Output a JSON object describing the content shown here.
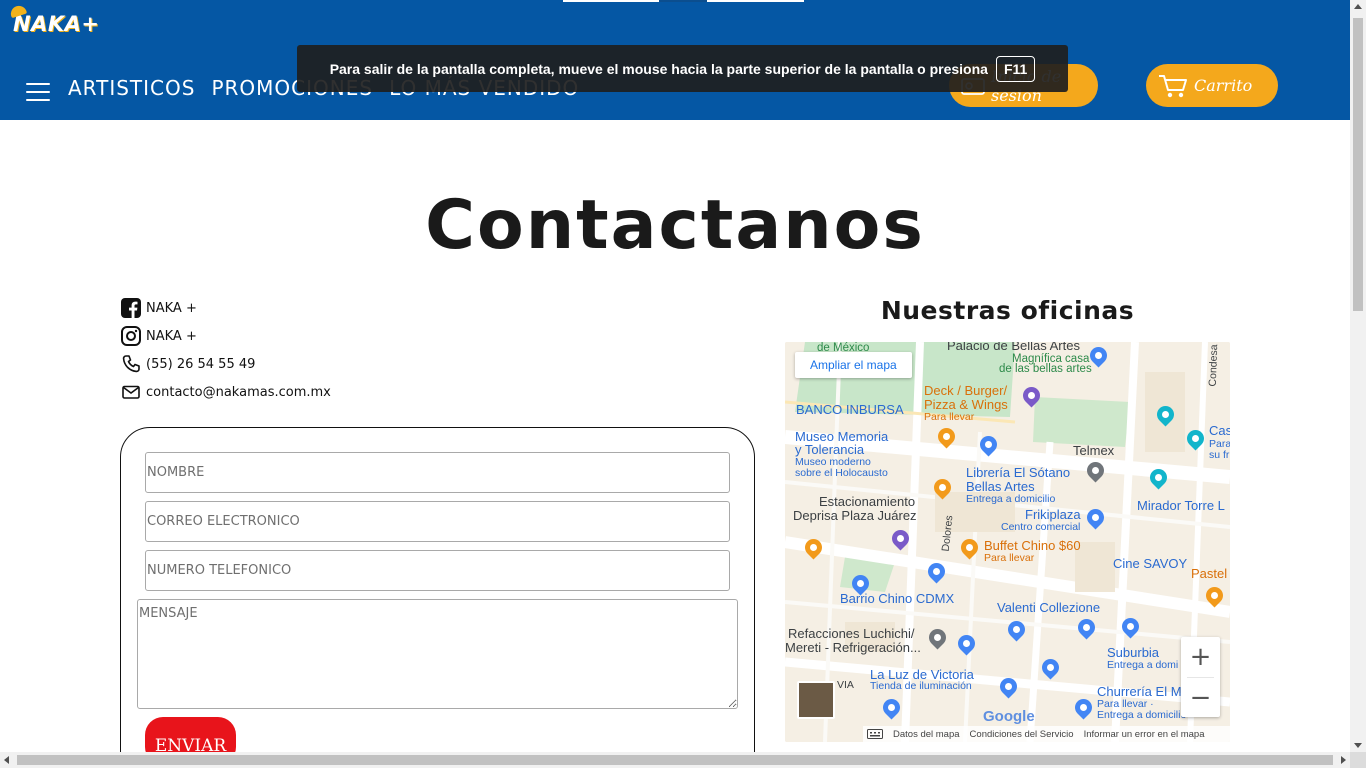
{
  "header": {
    "logo_text": "NAKA+",
    "nav": [
      "ARTISTICOS",
      "PROMOCIONES",
      "LO MÁS VENDIDO"
    ],
    "login_label": "Inicio de sesion",
    "cart_label": "Carrito"
  },
  "fullscreen_notice": {
    "message": "Para salir de la pantalla completa, mueve el mouse hacia la parte superior de la pantalla o presiona",
    "key": "F11"
  },
  "main": {
    "title": "Contactanos",
    "contacts": [
      {
        "icon": "facebook-icon",
        "text": "NAKA +"
      },
      {
        "icon": "instagram-icon",
        "text": "NAKA +"
      },
      {
        "icon": "phone-icon",
        "text": "(55) 26 54 55 49"
      },
      {
        "icon": "mail-icon",
        "text": "contacto@nakamas.com.mx"
      }
    ],
    "form": {
      "name_placeholder": "NOMBRE",
      "email_placeholder": "CORREO ELECTRONICO",
      "phone_placeholder": "NUMERO TELEFONICO",
      "message_placeholder": "MENSAJE",
      "submit_label": "ENVIAR"
    },
    "offices_title": "Nuestras oficinas"
  },
  "map": {
    "expand_label": "Ampliar el mapa",
    "labels": {
      "mexico": "de México",
      "palacio": "Palacio de Bellas Artes",
      "palacio_sub1": "Magnífica casa",
      "palacio_sub2": "de las bellas artes",
      "condesa": "Condesa",
      "deck1": "Deck / Burger/",
      "deck2": "Pizza & Wings",
      "deck_sub": "Para llevar",
      "inbursa": "BANCO INBURSA",
      "museo1": "Museo Memoria",
      "museo2": "y Tolerancia",
      "museo_sub1": "Museo moderno",
      "museo_sub2": "sobre el Holocausto",
      "telmex": "Telmex",
      "casa1": "Cas",
      "casa_sub1": "Para",
      "casa_sub2": "su fr",
      "libreria1": "Librería El Sótano",
      "libreria2": "Bellas Artes",
      "libreria_sub": "Entrega a domicilio",
      "mirador": "Mirador Torre L",
      "estacionamiento1": "Estacionamiento",
      "estacionamiento2": "Deprisa Plaza Juárez",
      "frikiplaza": "Frikiplaza",
      "frikiplaza_sub": "Centro comercial",
      "dolores": "Dolores",
      "buffet": "Buffet Chino $60",
      "buffet_sub": "Para llevar",
      "cine": "Cine SAVOY",
      "pastel": "Pastel",
      "barrio": "Barrio Chino CDMX",
      "valenti": "Valenti Collezione",
      "refacciones1": "Refacciones Luchichi/",
      "refacciones2": "Mereti - Refrigeración...",
      "suburbia": "Suburbia",
      "suburbia_sub": "Entrega a domi",
      "luz": "La Luz de Victoria",
      "luz_sub": "Tienda de iluminación",
      "churreria": "Churrería El Mo",
      "churreria_sub1": "Para llevar ·",
      "churreria_sub2": "Entrega a domicilio",
      "via": "VIA"
    },
    "google": "Google",
    "footer": [
      "Datos del mapa",
      "Condiciones del Servicio",
      "Informar un error en el mapa"
    ],
    "zoom_in": "+",
    "zoom_out": "−"
  },
  "colors": {
    "header_bg": "#0557a4",
    "button_orange": "#f4a81c",
    "send_red": "#e8141b"
  }
}
